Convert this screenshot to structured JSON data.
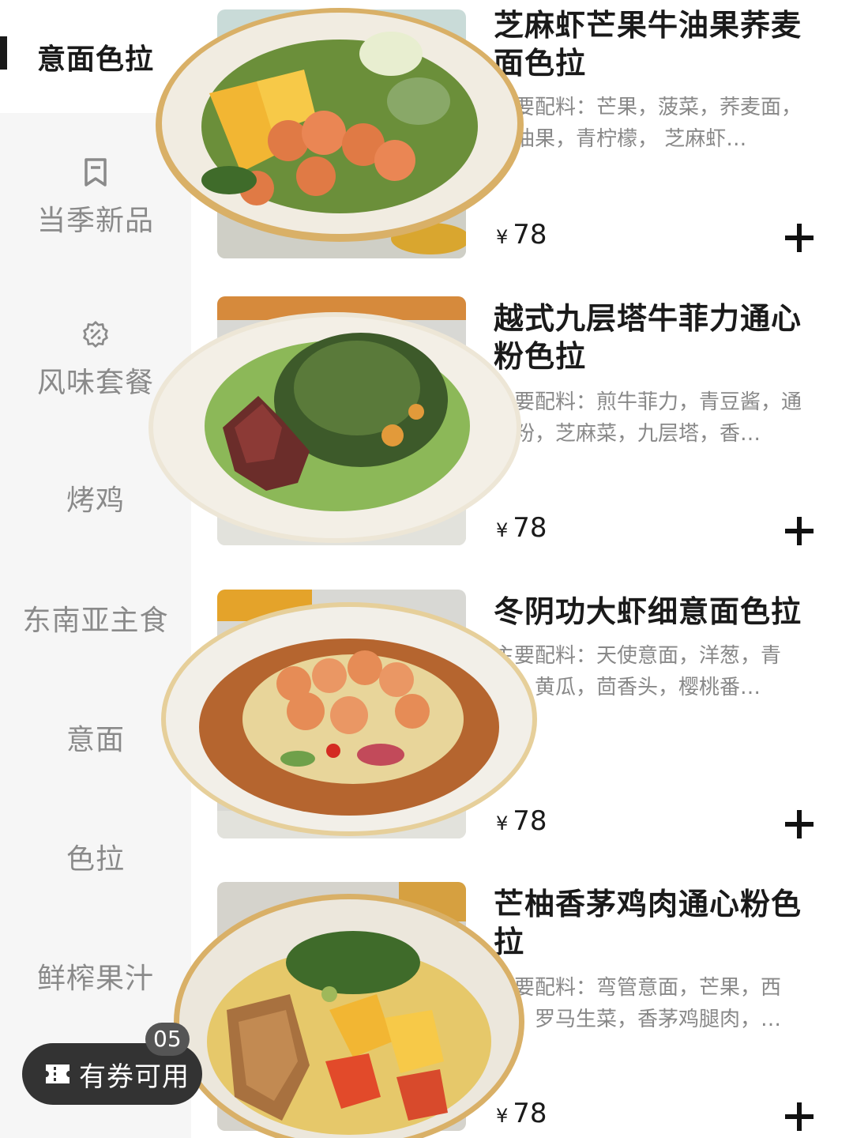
{
  "sidebar": {
    "categories": [
      {
        "label": "意面色拉",
        "active": true
      },
      {
        "label": "当季新品",
        "icon": "bookmark-icon"
      },
      {
        "label": "风味套餐",
        "icon": "discount-badge-icon"
      },
      {
        "label": "烤鸡"
      },
      {
        "label": "东南亚主食"
      },
      {
        "label": "意面"
      },
      {
        "label": "色拉"
      },
      {
        "label": "鲜榨果汁"
      }
    ],
    "coupon": {
      "label": "有券可用",
      "badge": "05",
      "icon": "ticket-icon"
    }
  },
  "products": [
    {
      "title": "芝麻虾芒果牛油果荞麦面色拉",
      "desc": "主要配料：芒果，菠菜，荞麦面，牛油果，青柠檬， 芝麻虾…",
      "currency": "¥",
      "price": "78"
    },
    {
      "title": "越式九层塔牛菲力通心粉色拉",
      "desc": "主要配料：煎牛菲力，青豆酱，通心粉，芝麻菜，九层塔，香…",
      "currency": "¥",
      "price": "78"
    },
    {
      "title": "冬阴功大虾细意面色拉",
      "desc": "主要配料：天使意面，洋葱，青瓜，黄瓜，茴香头，樱桃番…",
      "currency": "¥",
      "price": "78"
    },
    {
      "title": "芒柚香茅鸡肉通心粉色拉",
      "desc": "主要配料：弯管意面，芒果，西芹，罗马生菜，香茅鸡腿肉，…",
      "currency": "¥",
      "price": "78"
    }
  ]
}
